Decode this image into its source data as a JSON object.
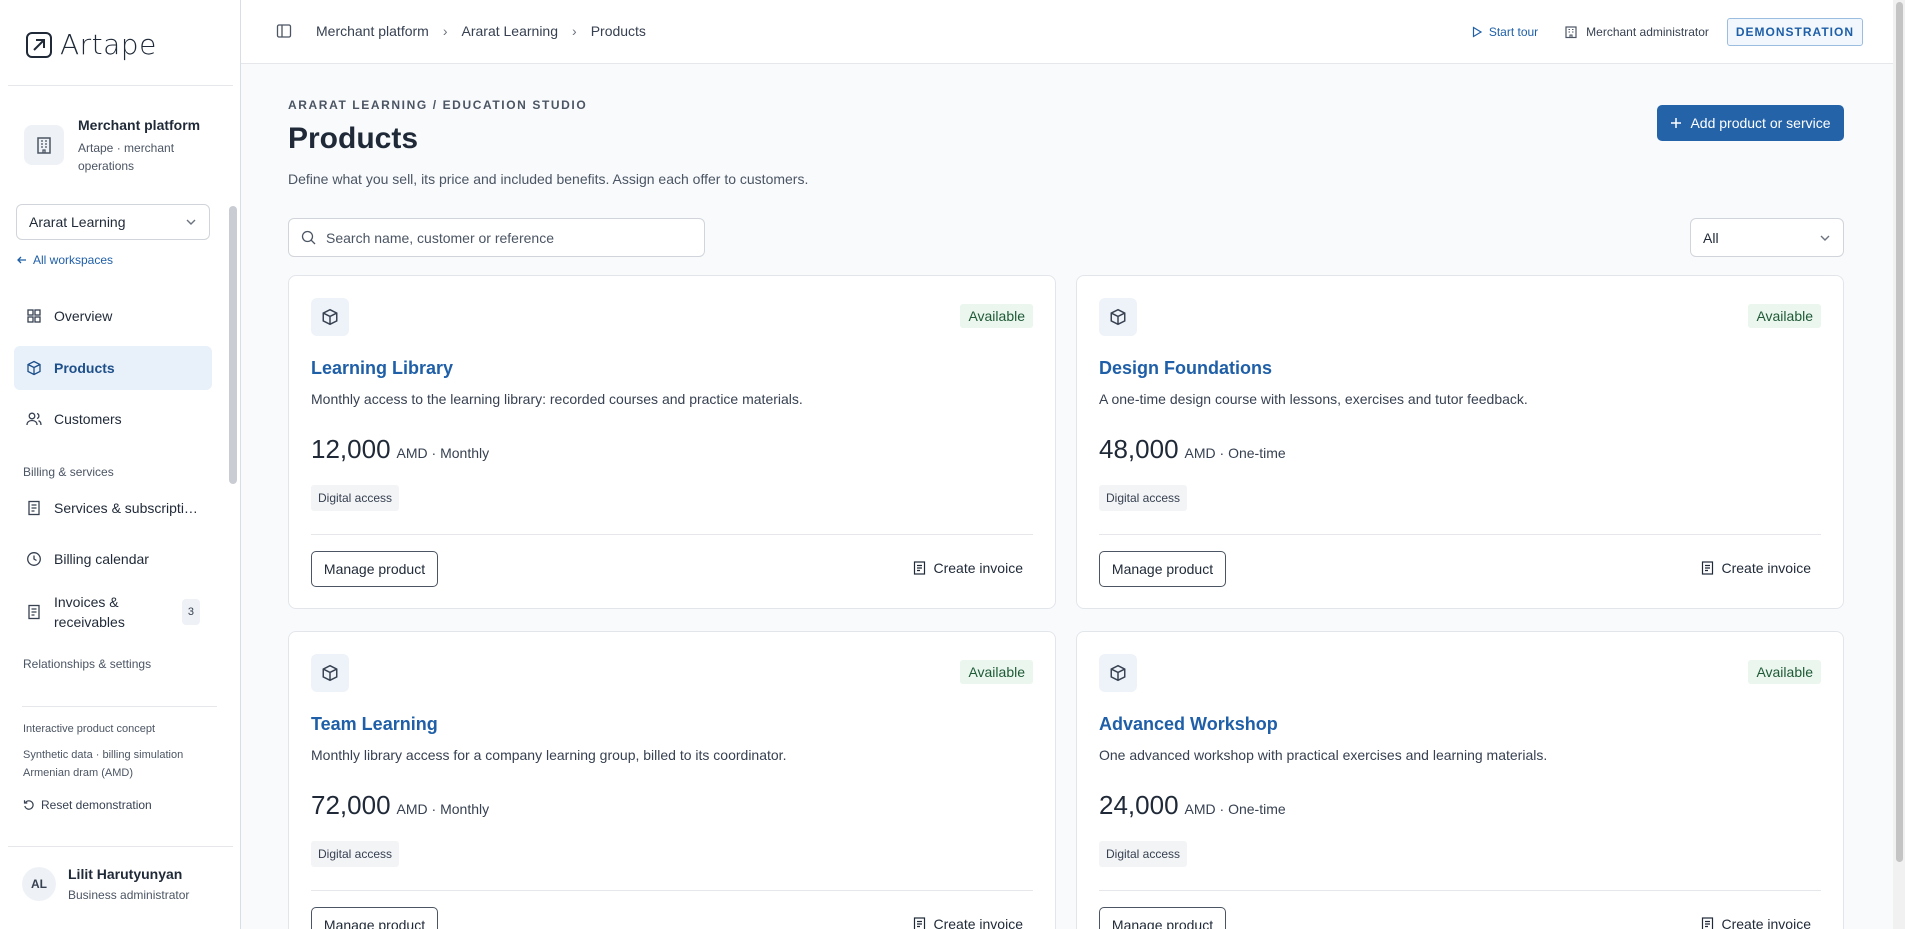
{
  "sidebar": {
    "logo_text": "Artape",
    "merchant": {
      "title": "Merchant platform",
      "subtitle": "Artape · merchant operations"
    },
    "workspace": "Ararat Learning",
    "all_workspaces": "All workspaces",
    "nav": [
      {
        "label": "Overview",
        "icon": "grid-icon"
      },
      {
        "label": "Products",
        "icon": "box-icon",
        "active": true
      },
      {
        "label": "Customers",
        "icon": "users-icon"
      }
    ],
    "section_billing": "Billing & services",
    "billing_nav": [
      {
        "label": "Services & subscripti…",
        "icon": "document-icon"
      },
      {
        "label": "Billing calendar",
        "icon": "clock-icon"
      },
      {
        "label": "Invoices & receivables",
        "icon": "invoice-icon",
        "badge": "3"
      }
    ],
    "section_relationships": "Relationships & settings",
    "footer": {
      "concept": "Interactive product concept",
      "synthetic": "Synthetic data · billing simulation",
      "currency": "Armenian dram (AMD)",
      "reset": "Reset demonstration"
    },
    "user": {
      "initials": "AL",
      "name": "Lilit Harutyunyan",
      "role": "Business administrator"
    }
  },
  "topbar": {
    "breadcrumbs": [
      "Merchant platform",
      "Ararat Learning",
      "Products"
    ],
    "start_tour": "Start tour",
    "role": "Merchant administrator",
    "badge": "DEMONSTRATION"
  },
  "main": {
    "eyebrow": "ARARAT LEARNING / EDUCATION STUDIO",
    "title": "Products",
    "description": "Define what you sell, its price and included benefits. Assign each offer to customers.",
    "add_button": "Add product or service",
    "search_placeholder": "Search name, customer or reference",
    "filter_value": "All",
    "manage_label": "Manage product",
    "invoice_label": "Create invoice",
    "products": [
      {
        "name": "Learning Library",
        "status": "Available",
        "description": "Monthly access to the learning library: recorded courses and practice materials.",
        "price": "12,000",
        "unit": "AMD · Monthly",
        "tag": "Digital access"
      },
      {
        "name": "Design Foundations",
        "status": "Available",
        "description": "A one-time design course with lessons, exercises and tutor feedback.",
        "price": "48,000",
        "unit": "AMD · One-time",
        "tag": "Digital access"
      },
      {
        "name": "Team Learning",
        "status": "Available",
        "description": "Monthly library access for a company learning group, billed to its coordinator.",
        "price": "72,000",
        "unit": "AMD · Monthly",
        "tag": "Digital access"
      },
      {
        "name": "Advanced Workshop",
        "status": "Available",
        "description": "One advanced workshop with practical exercises and learning materials.",
        "price": "24,000",
        "unit": "AMD · One-time",
        "tag": "Digital access"
      }
    ]
  },
  "colors": {
    "accent": "#2563a8",
    "link": "#1f5fa8",
    "available_bg": "#eaf6ee",
    "active_nav_bg": "#e8f0fa"
  }
}
